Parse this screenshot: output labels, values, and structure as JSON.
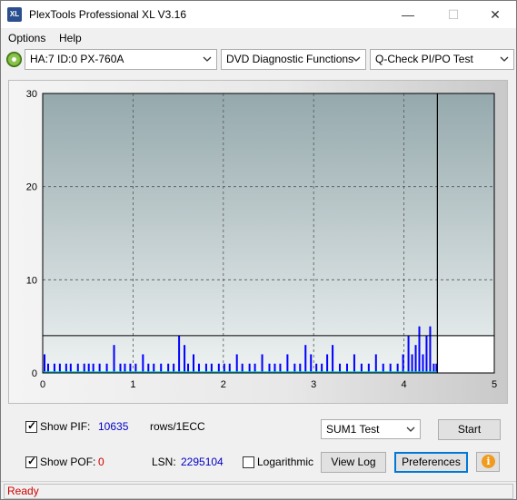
{
  "window": {
    "title": "PlexTools Professional XL V3.16",
    "app_icon_text": "XL",
    "minimize_glyph": "—",
    "maximize_glyph": "☐",
    "close_glyph": "✕"
  },
  "menu": {
    "options": "Options",
    "help": "Help"
  },
  "toolbar": {
    "drive": "HA:7 ID:0  PX-760A",
    "function": "DVD Diagnostic Functions",
    "test": "Q-Check PI/PO Test"
  },
  "chart_data": {
    "type": "bar",
    "xlim": [
      0,
      5
    ],
    "ylim": [
      0,
      30
    ],
    "x_ticks": [
      "0",
      "1",
      "2",
      "3",
      "4",
      "5"
    ],
    "y_ticks": [
      "0",
      "10",
      "20",
      "30"
    ],
    "threshold_y": 4,
    "end_x": 4.37,
    "grid": true,
    "plot_bg_top": "#95a9ad",
    "plot_bg_bottom": "#eef2f2",
    "bar_color": "#0000ff",
    "po_color": "#00c8c8",
    "pi_values_note_series": "PIF",
    "series": [
      {
        "name": "PIF",
        "x": [
          0.01,
          0.05,
          0.12,
          0.18,
          0.25,
          0.3,
          0.38,
          0.45,
          0.5,
          0.55,
          0.62,
          0.7,
          0.78,
          0.85,
          0.9,
          0.96,
          1.02,
          1.1,
          1.16,
          1.22,
          1.3,
          1.38,
          1.44,
          1.5,
          1.56,
          1.6,
          1.66,
          1.72,
          1.8,
          1.86,
          1.94,
          2.0,
          2.06,
          2.14,
          2.2,
          2.28,
          2.34,
          2.42,
          2.5,
          2.56,
          2.62,
          2.7,
          2.78,
          2.84,
          2.9,
          2.96,
          3.02,
          3.08,
          3.14,
          3.2,
          3.28,
          3.36,
          3.44,
          3.52,
          3.6,
          3.68,
          3.76,
          3.84,
          3.92,
          3.98,
          4.04,
          4.08,
          4.12,
          4.16,
          4.2,
          4.24,
          4.28,
          4.32,
          4.35
        ],
        "values": [
          2,
          1,
          1,
          1,
          1,
          1,
          1,
          1,
          1,
          1,
          1,
          1,
          3,
          1,
          1,
          1,
          1,
          2,
          1,
          1,
          1,
          1,
          1,
          4,
          3,
          1,
          2,
          1,
          1,
          1,
          1,
          1,
          1,
          2,
          1,
          1,
          1,
          2,
          1,
          1,
          1,
          2,
          1,
          1,
          3,
          2,
          1,
          1,
          2,
          3,
          1,
          1,
          2,
          1,
          1,
          2,
          1,
          1,
          1,
          2,
          4,
          2,
          3,
          5,
          2,
          4,
          5,
          1,
          1
        ]
      }
    ]
  },
  "controls": {
    "show_pif_label": "Show PIF:",
    "pif_value": "10635",
    "rows_label": "rows/1ECC",
    "show_pof_label": "Show POF:",
    "pof_value": "0",
    "lsn_label": "LSN:",
    "lsn_value": "2295104",
    "logarithmic_label": "Logarithmic",
    "sum_select": "SUM1 Test",
    "start_button": "Start",
    "viewlog_button": "View Log",
    "preferences_button": "Preferences",
    "info_glyph": "i",
    "check_glyph": "✓"
  },
  "status": {
    "text": "Ready"
  }
}
